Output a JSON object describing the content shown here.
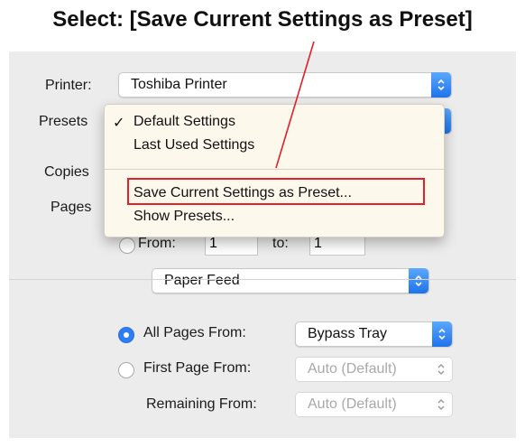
{
  "caption": "Select:  [Save Current Settings as Preset]",
  "printer": {
    "label": "Printer:",
    "value": "Toshiba Printer"
  },
  "presets": {
    "label": "Presets"
  },
  "copies": {
    "label": "Copies"
  },
  "pages": {
    "label": "Pages",
    "from_label": "From:",
    "from_value": "1",
    "to_label": "to:",
    "to_value": "1"
  },
  "menu": {
    "items": [
      {
        "label": "Default Settings",
        "checked": true
      },
      {
        "label": "Last Used Settings",
        "checked": false
      },
      {
        "label": "Save Current Settings as Preset...",
        "checked": false
      },
      {
        "label": "Show Presets...",
        "checked": false
      }
    ]
  },
  "section": {
    "value": "Paper Feed"
  },
  "feed": {
    "all_pages_label": "All Pages From:",
    "all_pages_value": "Bypass Tray",
    "first_page_label": "First Page From:",
    "first_page_value": "Auto (Default)",
    "remaining_label": "Remaining From:",
    "remaining_value": "Auto (Default)"
  },
  "colors": {
    "accent": "#2f7df6",
    "highlight": "#e0202a",
    "menu_bg": "#fdf8ec"
  }
}
